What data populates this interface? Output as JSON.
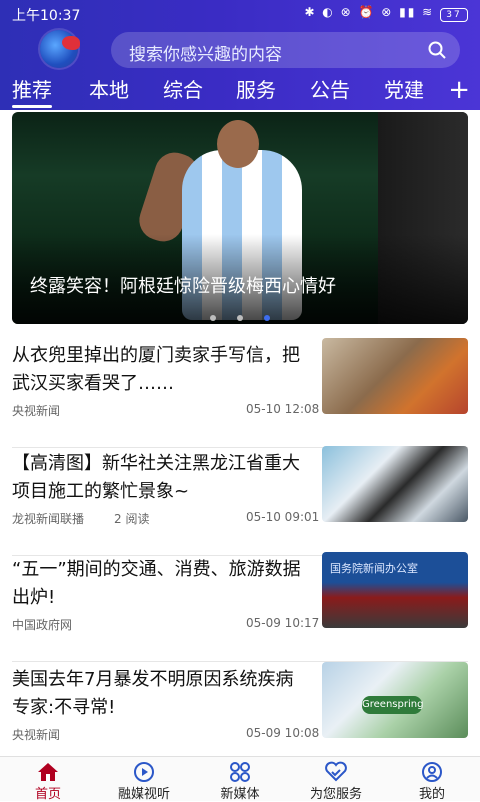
{
  "status_bar": {
    "time": "上午10:37",
    "indicators": "✱ ◐ ⊗ ⏰ ⊗ ▮▮ ≋",
    "battery": "37"
  },
  "header": {
    "search": {
      "placeholder": "搜索你感兴趣的内容"
    },
    "tabs": [
      {
        "label": "推荐",
        "active": true
      },
      {
        "label": "本地",
        "active": false
      },
      {
        "label": "综合",
        "active": false
      },
      {
        "label": "服务",
        "active": false
      },
      {
        "label": "公告",
        "active": false
      },
      {
        "label": "党建",
        "active": false
      }
    ],
    "more_label": "+"
  },
  "banner": {
    "caption": "终露笑容！阿根廷惊险晋级梅西心情好",
    "pagination": {
      "total": 3,
      "current": 3
    }
  },
  "news": [
    {
      "title": "从衣兜里掉出的厦门卖家手写信，把武汉买家看哭了……",
      "source": "央视新闻",
      "reads": "",
      "date": "05-10 12:08"
    },
    {
      "title": "【高清图】新华社关注黑龙江省重大项目施工的繁忙景象~",
      "source": "龙视新闻联播",
      "reads": "2 阅读",
      "date": "05-10 09:01"
    },
    {
      "title": "“五一”期间的交通、消费、旅游数据出炉!",
      "source": "中国政府网",
      "reads": "",
      "date": "05-09 10:17"
    },
    {
      "title": "美国去年7月暴发不明原因系统疾病 专家:不寻常!",
      "source": "央视新闻",
      "reads": "",
      "date": "05-09 10:08"
    }
  ],
  "thumb_texts": {
    "news3": "国务院新闻办公室",
    "news4": "Greenspring"
  },
  "bottom_nav": [
    {
      "label": "首页",
      "icon": "home-icon",
      "active": true
    },
    {
      "label": "融媒视听",
      "icon": "play-icon",
      "active": false
    },
    {
      "label": "新媒体",
      "icon": "grid-icon",
      "active": false
    },
    {
      "label": "为您服务",
      "icon": "handshake-icon",
      "active": false
    },
    {
      "label": "我的",
      "icon": "user-icon",
      "active": false
    }
  ],
  "colors": {
    "header": "#3a2cc4",
    "active_nav": "#b00020",
    "active_dot": "#3d6df0"
  }
}
